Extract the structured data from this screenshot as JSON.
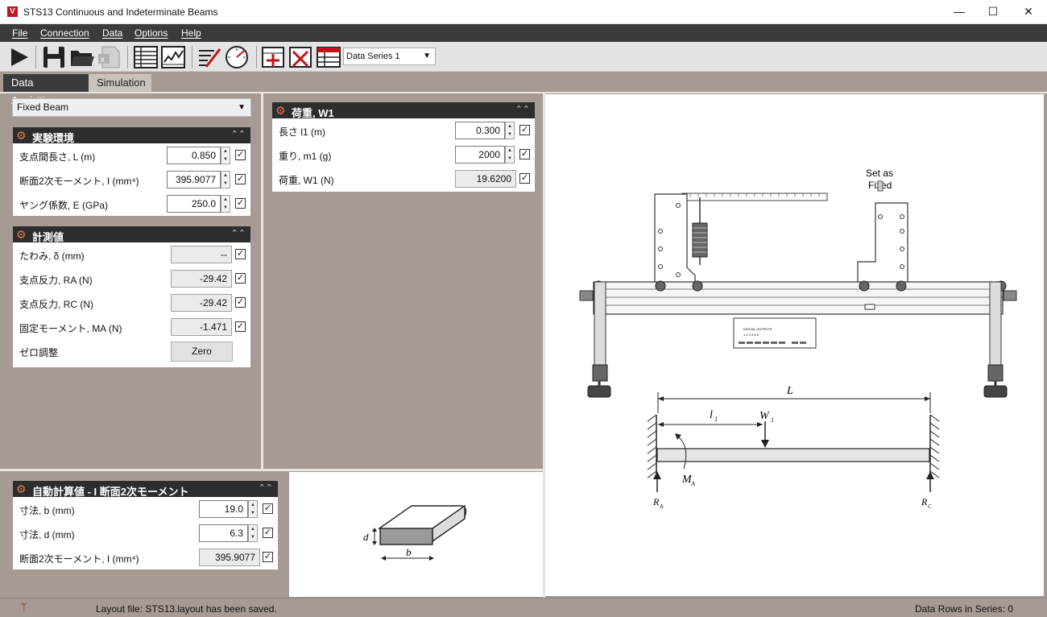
{
  "window": {
    "title": "STS13 Continuous and Indeterminate Beams",
    "minimize": "—",
    "maximize": "☐",
    "close": "✕"
  },
  "menu": [
    "File",
    "Connection",
    "Data",
    "Options",
    "Help"
  ],
  "toolbar": {
    "series_select": "Data Series 1",
    "icons": [
      "play-icon",
      "save-icon",
      "open-folder-icon",
      "export-excel-icon",
      "table-icon",
      "graph-icon",
      "edit-icon",
      "gauge-icon",
      "add-row-icon",
      "delete-row-icon",
      "table-settings-icon"
    ]
  },
  "tabs": {
    "active": "Data Aquisition",
    "inactive": "Simulation"
  },
  "beam_type": "Fixed Beam",
  "env": {
    "title": "実験環境",
    "rows": [
      {
        "label": "支点間長さ, L (m)",
        "value": "0.850"
      },
      {
        "label": "断面2次モーメント, I (mm⁴)",
        "value": "395.9077"
      },
      {
        "label": "ヤング係数, E (GPa)",
        "value": "250.0"
      }
    ]
  },
  "measured": {
    "title": "計測値",
    "rows": [
      {
        "label": "たわみ, δ (mm)",
        "value": "--"
      },
      {
        "label": "支点反力, RA (N)",
        "value": "-29.42"
      },
      {
        "label": "支点反力, RC (N)",
        "value": "-29.42"
      },
      {
        "label": "固定モーメント, MA (N)",
        "value": "-1.471"
      }
    ],
    "zero_label": "ゼロ調整",
    "zero_button": "Zero"
  },
  "load": {
    "title": "荷重, W1",
    "rows": [
      {
        "label": "長さ l1 (m)",
        "value": "0.300"
      },
      {
        "label": "重り, m1 (g)",
        "value": "2000"
      },
      {
        "label": "荷重, W1 (N)",
        "value": "19.6200"
      }
    ]
  },
  "auto": {
    "title": "自動計算値 - I 断面2次モーメント",
    "rows": [
      {
        "label": "寸法, b (mm)",
        "value": "19.0"
      },
      {
        "label": "寸法, d (mm)",
        "value": "6.3"
      },
      {
        "label": "断面2次モーメント, I (mm⁴)",
        "value": "395.9077"
      }
    ]
  },
  "section_diagram": {
    "d": "d",
    "b": "b"
  },
  "apparatus": {
    "fixed_note_line1": "Set as",
    "fixed_note_line2": "Fixed",
    "panel_label": "DIGITAL OUTPUTS",
    "panel_nums": "1  2  3  4  5  6"
  },
  "beam_diagram": {
    "L": "L",
    "l1": "l",
    "l1_sub": "1",
    "W1": "W",
    "W1_sub": "1",
    "MA": "M",
    "MA_sub": "A",
    "RA": "R",
    "RA_sub": "A",
    "RC": "R",
    "RC_sub": "C"
  },
  "status": {
    "message": "Layout file: STS13.layout has been saved.",
    "rows": "Data Rows in Series: 0"
  }
}
